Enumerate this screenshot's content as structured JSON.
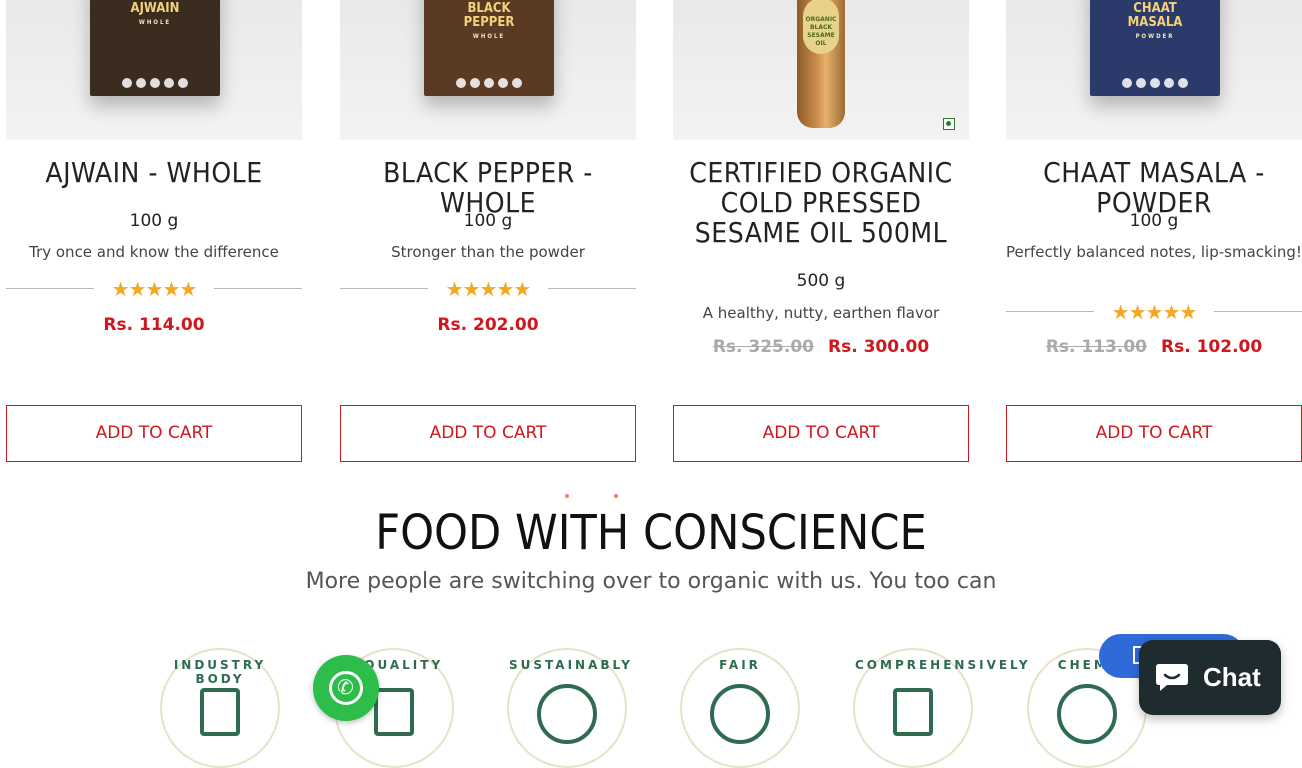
{
  "products": [
    {
      "title": "AJWAIN - WHOLE",
      "weight": "100 g",
      "desc": "Try once and know the difference",
      "rating": 5,
      "price_new": "Rs. 114.00",
      "price_old": "",
      "box_label": "AJWAIN",
      "box_sub": "WHOLE",
      "box_color": "#3a2d20",
      "button": "ADD TO CART"
    },
    {
      "title": "BLACK PEPPER - WHOLE",
      "weight": "100 g",
      "desc": "Stronger than the powder",
      "rating": 5,
      "price_new": "Rs. 202.00",
      "price_old": "",
      "box_label": "BLACK PEPPER",
      "box_sub": "WHOLE",
      "box_color": "#5a3a22",
      "button": "ADD TO CART"
    },
    {
      "title": "CERTIFIED ORGANIC COLD PRESSED SESAME OIL 500ML",
      "weight": "500 g",
      "desc": "A healthy, nutty, earthen flavor",
      "rating": null,
      "price_new": "Rs. 300.00",
      "price_old": "Rs. 325.00",
      "box_label": "ORGANIC BLACK SESAME OIL",
      "box_sub": "",
      "box_color": "",
      "button": "ADD TO CART"
    },
    {
      "title": "CHAAT MASALA - POWDER",
      "weight": "100 g",
      "desc": "Perfectly balanced notes, lip-smacking!",
      "rating": 5,
      "price_new": "Rs. 102.00",
      "price_old": "Rs. 113.00",
      "box_label": "CHAAT MASALA",
      "box_sub": "POWDER",
      "box_color": "#2b3a6a",
      "button": "ADD TO CART"
    }
  ],
  "section": {
    "heading": "FOOD WITH CONSCIENCE",
    "subheading": "More people are switching over to organic with us. You too can"
  },
  "badges": [
    {
      "text": "INDUSTRY BODY",
      "icon": "certificate-icon"
    },
    {
      "text": "R QUALITY",
      "icon": "hand-ok-icon"
    },
    {
      "text": "SUSTAINABLY",
      "icon": "plant-globe-icon"
    },
    {
      "text": "FAIR",
      "icon": "yin-yang-icon"
    },
    {
      "text": "COMPREHENSIVELY",
      "icon": "checklist-icon"
    },
    {
      "text": "CHEMI",
      "icon": "no-chemical-icon"
    }
  ],
  "chat": {
    "label": "Chat"
  },
  "colors": {
    "accent": "#d0171d",
    "star": "#f5a623",
    "badge_green": "#2f6b4f",
    "chat_bg": "#1e2b2f",
    "whatsapp": "#2dbd4a"
  }
}
